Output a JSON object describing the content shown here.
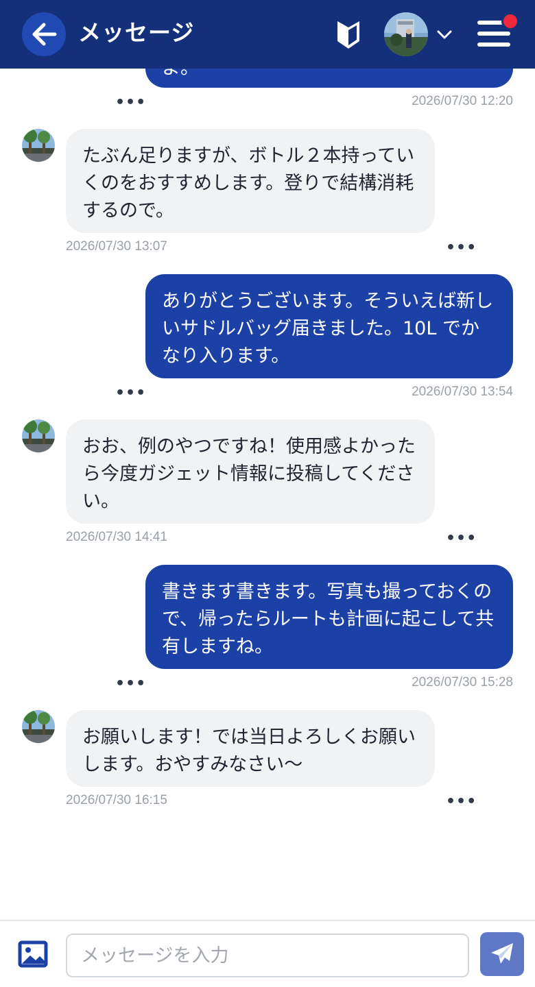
{
  "header": {
    "title": "メッセージ",
    "back_icon": "arrow-left-icon",
    "beginner_icon": "beginner-mark-icon",
    "menu_icon": "hamburger-menu-icon",
    "colors": {
      "bar": "#14307a",
      "notification": "#f0283c"
    }
  },
  "messages": [
    {
      "direction": "out",
      "text": "よ。",
      "time": "2026/07/30 12:20",
      "more": "•••"
    },
    {
      "direction": "in",
      "text": "たぶん足りますが、ボトル２本持っていくのをおすすめします。登りで結構消耗するので。",
      "time": "2026/07/30 13:07",
      "more": "•••"
    },
    {
      "direction": "out",
      "text": "ありがとうございます。そういえば新しいサドルバッグ届きました。10L でかなり入ります。",
      "time": "2026/07/30 13:54",
      "more": "•••"
    },
    {
      "direction": "in",
      "text": "おお、例のやつですね！使用感よかったら今度ガジェット情報に投稿してください。",
      "time": "2026/07/30 14:41",
      "more": "•••"
    },
    {
      "direction": "out",
      "text": "書きます書きます。写真も撮っておくので、帰ったらルートも計画に起こして共有しますね。",
      "time": "2026/07/30 15:28",
      "more": "•••"
    },
    {
      "direction": "in",
      "text": "お願いします！では当日よろしくお願いします。おやすみなさい〜",
      "time": "2026/07/30 16:15",
      "more": "•••"
    }
  ],
  "composer": {
    "placeholder": "メッセージを入力",
    "value": "",
    "image_icon": "image-upload-icon",
    "send_icon": "send-paper-plane-icon"
  },
  "colors": {
    "outgoing_bubble": "#1b41a6",
    "incoming_bubble": "#f1f2f4",
    "send_button": "#5e78c6"
  }
}
